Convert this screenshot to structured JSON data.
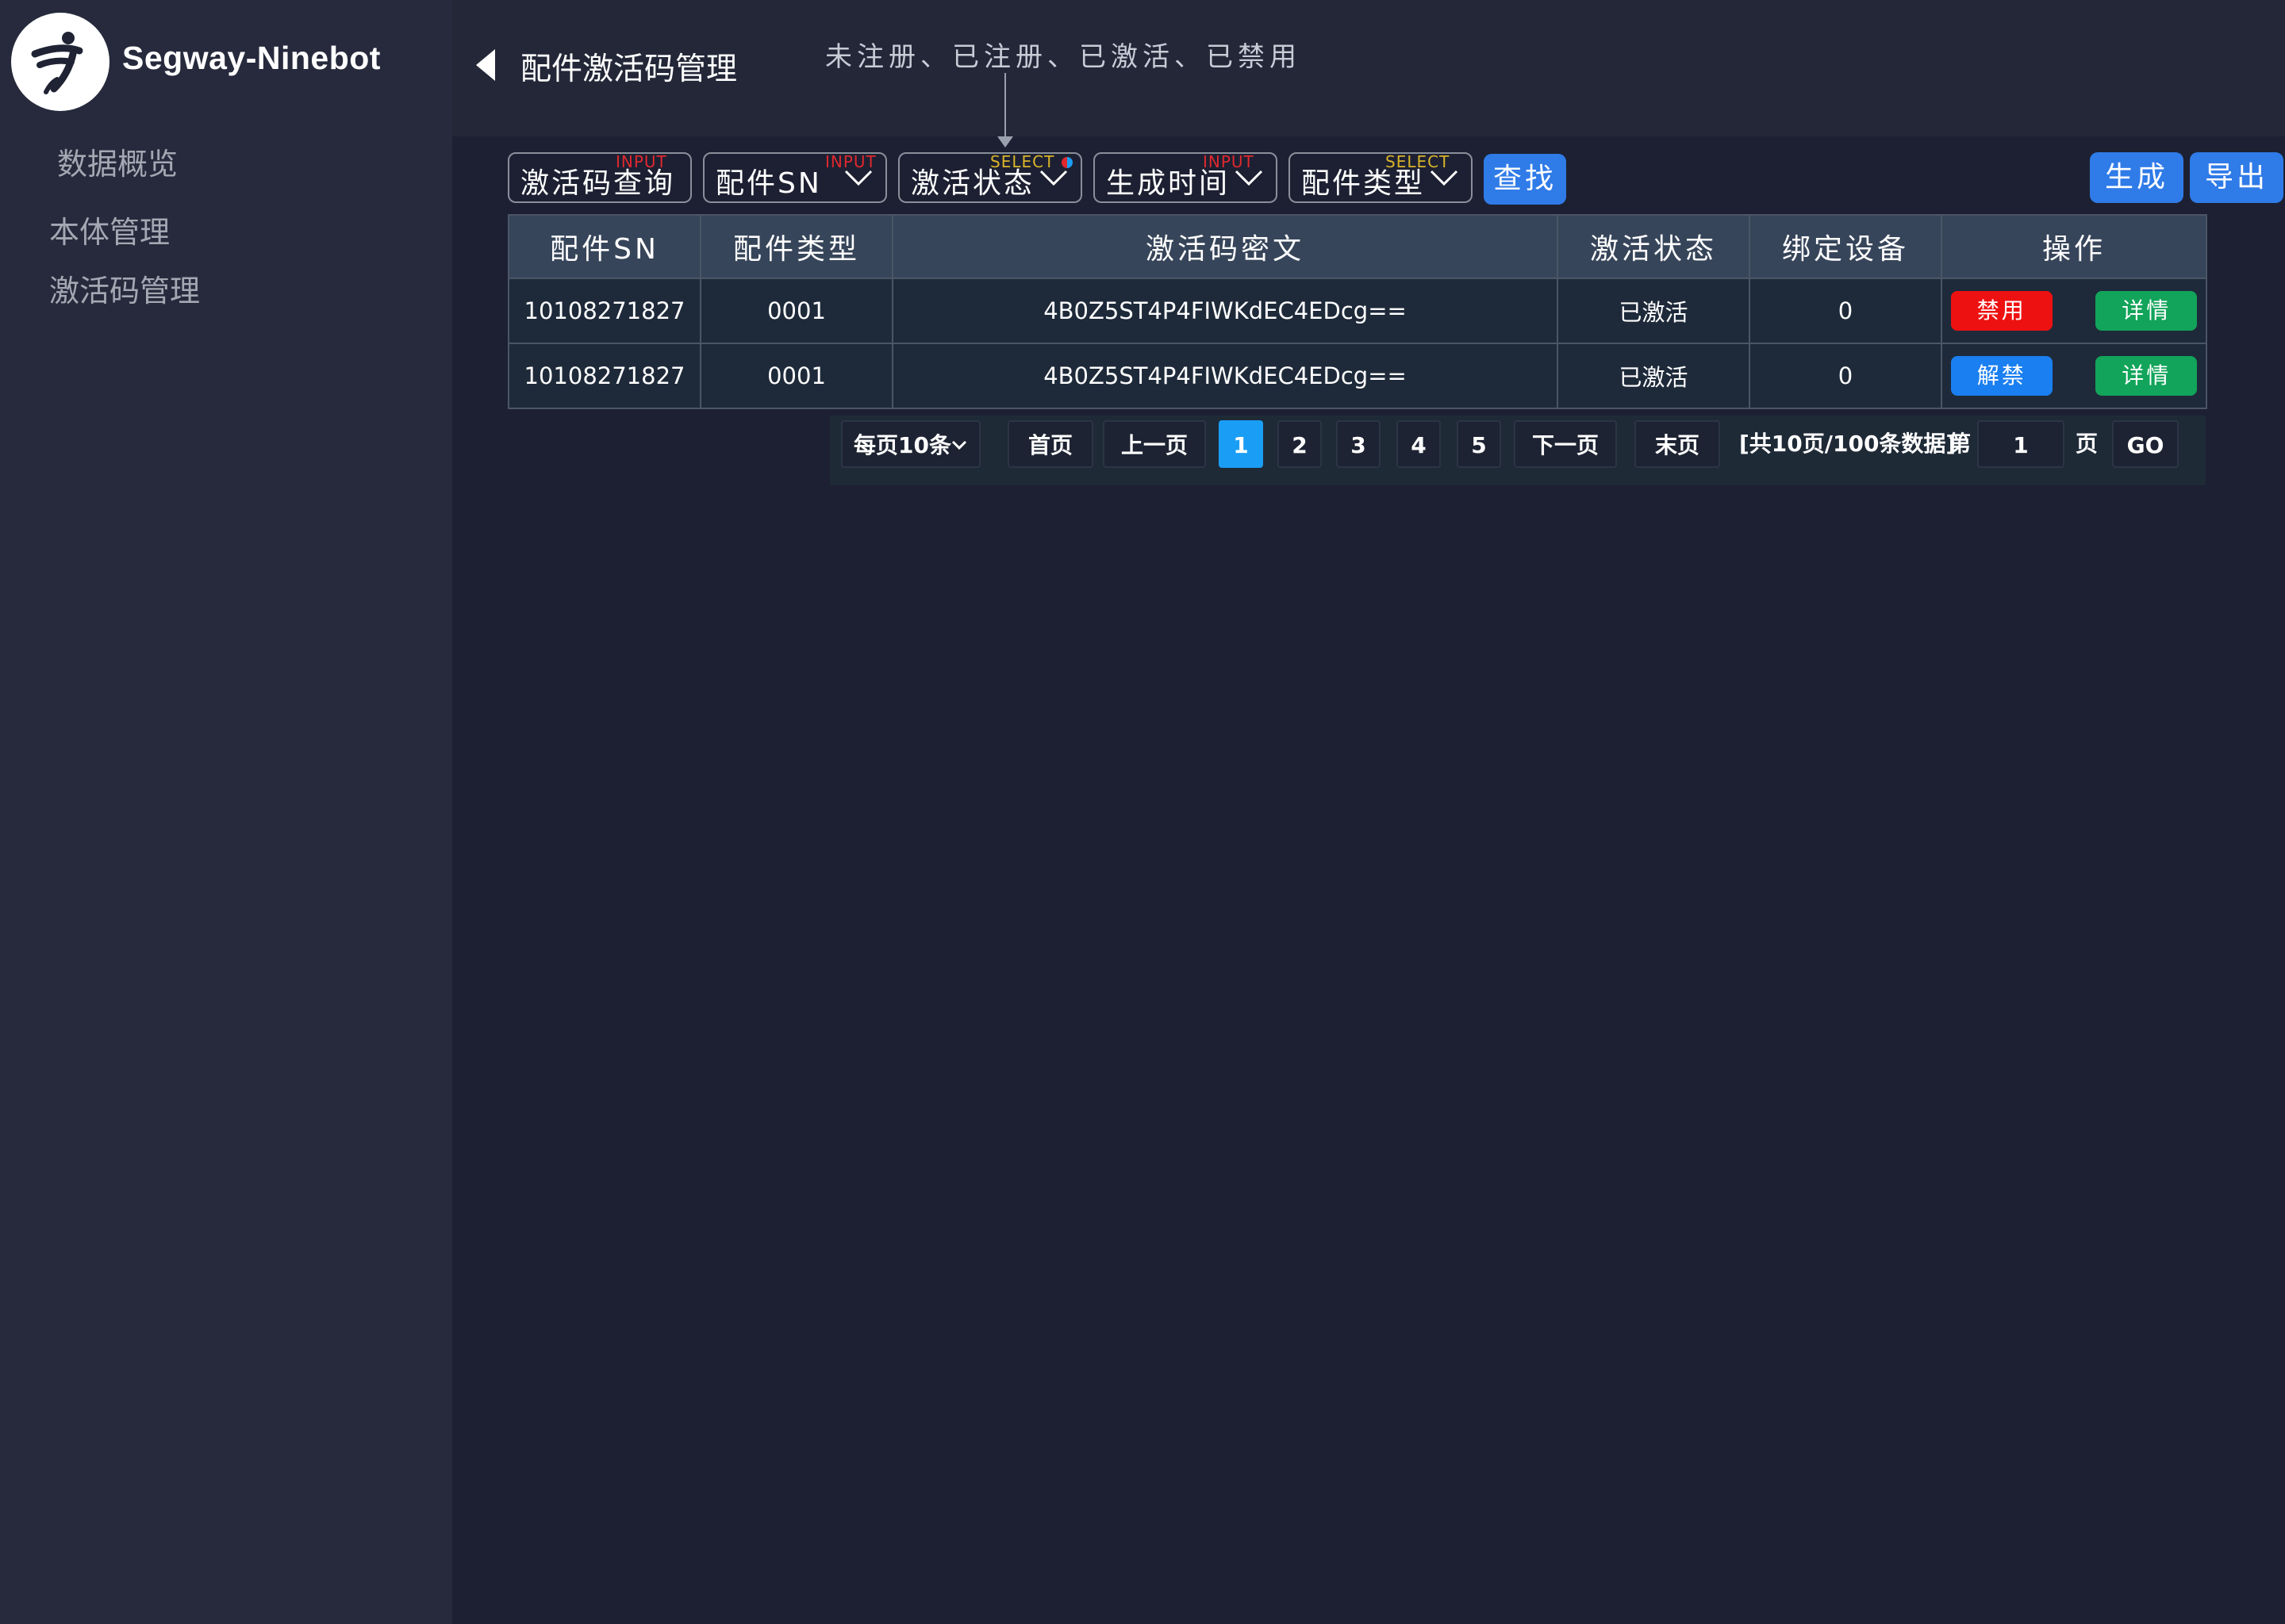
{
  "brand": {
    "name": "Segway-Ninebot"
  },
  "header": {
    "title": "配件激活码管理",
    "annotation": "未注册、已注册、已激活、已禁用"
  },
  "sidebar": {
    "items": [
      {
        "label": "数据概览"
      },
      {
        "label": "本体管理"
      },
      {
        "label": "激活码管理"
      }
    ]
  },
  "filters": [
    {
      "label": "激活码查询",
      "tag": "INPUT"
    },
    {
      "label": "配件SN",
      "tag": "INPUT"
    },
    {
      "label": "激活状态",
      "tag": "SELECT"
    },
    {
      "label": "生成时间",
      "tag": "INPUT"
    },
    {
      "label": "配件类型",
      "tag": "SELECT"
    }
  ],
  "buttons": {
    "search": "查找",
    "generate": "生成",
    "export": "导出"
  },
  "table": {
    "columns": [
      "配件SN",
      "配件类型",
      "激活码密文",
      "激活状态",
      "绑定设备",
      "操作"
    ],
    "rows": [
      {
        "sn": "10108271827",
        "type": "0001",
        "cipher": "4B0Z5ST4P4FIWKdEC4EDcg==",
        "status": "已激活",
        "device": "0",
        "action": "禁用",
        "detail": "详情"
      },
      {
        "sn": "10108271827",
        "type": "0001",
        "cipher": "4B0Z5ST4P4FIWKdEC4EDcg==",
        "status": "已激活",
        "device": "0",
        "action": "解禁",
        "detail": "详情"
      }
    ]
  },
  "pagination": {
    "per_page": "每页10条",
    "first": "首页",
    "prev": "上一页",
    "pages": [
      "1",
      "2",
      "3",
      "4",
      "5"
    ],
    "current": "1",
    "next": "下一页",
    "last": "末页",
    "summary": "[共10页/100条数据]",
    "goto_prefix": "第",
    "goto_value": "1",
    "goto_suffix": "页",
    "go": "GO"
  }
}
